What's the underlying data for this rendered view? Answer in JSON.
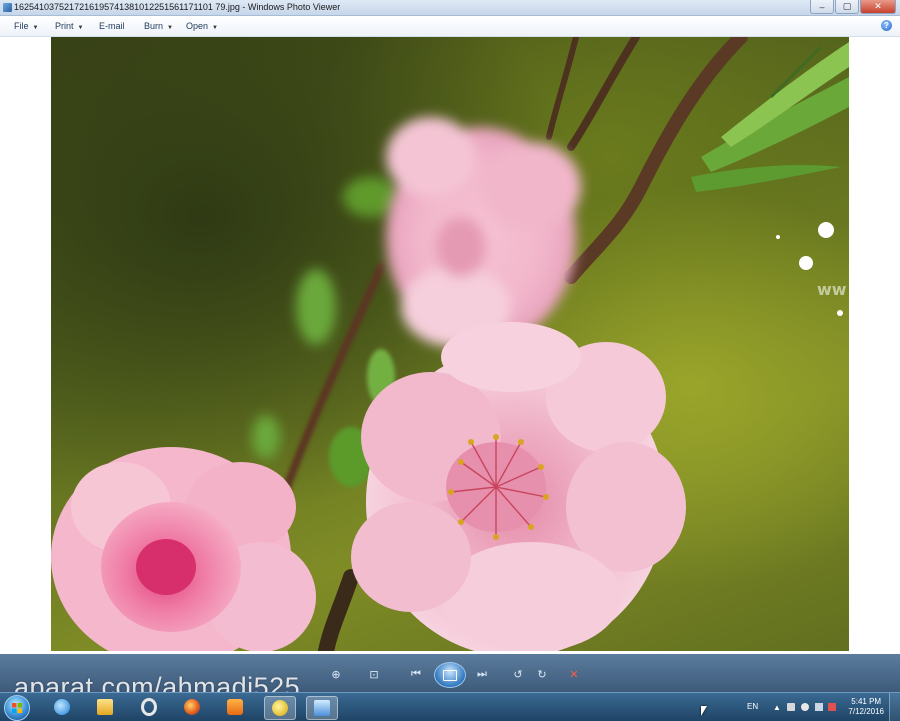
{
  "window": {
    "title": "1625410375217216195741381012251561171101 79.jpg - Windows Photo Viewer",
    "minimize_glyph": "–",
    "maximize_glyph": "▢",
    "close_glyph": "✕"
  },
  "menu": {
    "items": [
      {
        "label": "File"
      },
      {
        "label": "Print"
      },
      {
        "label": "E-mail"
      },
      {
        "label": "Burn"
      },
      {
        "label": "Open"
      }
    ],
    "dropdown_arrow": "▼",
    "help_label": "?"
  },
  "photo": {
    "icons": [
      "peach-blossom-photo"
    ],
    "partial_watermark": "ww"
  },
  "toolbar": {
    "icons": [
      "zoom-icon",
      "actual-size-icon",
      "previous-icon",
      "slideshow-icon",
      "next-icon",
      "rotate-left-icon",
      "rotate-right-icon",
      "delete-icon"
    ],
    "zoom_glyph": "⊕",
    "fit_glyph": "⊡",
    "previous_glyph": "⏮",
    "next_glyph": "⏭",
    "rotate_left_glyph": "↺",
    "rotate_right_glyph": "↻",
    "delete_glyph": "✕"
  },
  "watermark": {
    "text": "aparat.com/ahmadi525"
  },
  "taskbar": {
    "apps": [
      "internet-explorer-icon",
      "file-explorer-icon",
      "opera-icon",
      "firefox-icon",
      "media-player-icon",
      "app-icon",
      "photo-viewer-icon"
    ],
    "language": "EN",
    "time": "5:41 PM",
    "date": "7/12/2016",
    "tray_arrow": "▲"
  }
}
